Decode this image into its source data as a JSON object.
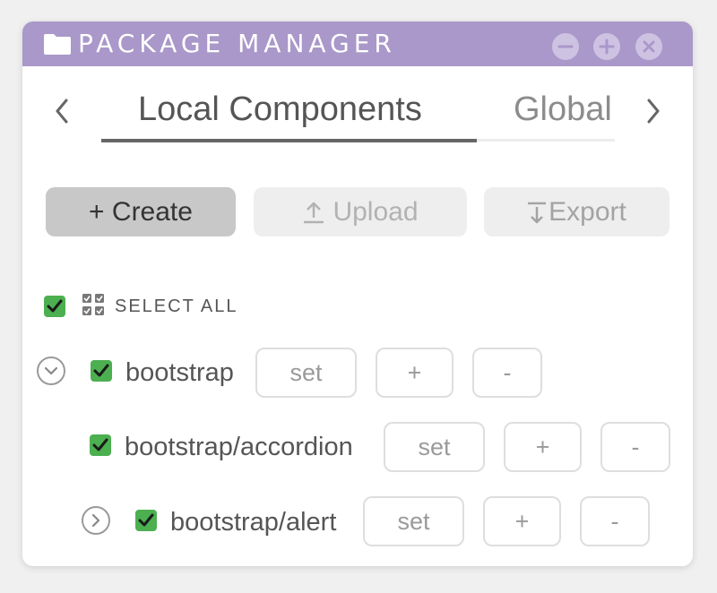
{
  "window": {
    "title": "PACKAGE MANAGER",
    "accent_color": "#a998c9",
    "controls": [
      "minimize-icon",
      "maximize-icon",
      "close-icon"
    ]
  },
  "tabs": {
    "items": [
      {
        "label": "Local Components",
        "active": true
      },
      {
        "label": "Global",
        "active": false
      }
    ]
  },
  "toolbar": {
    "create_label": "+ Create",
    "upload_label": "Upload",
    "export_label": "Export"
  },
  "select_all": {
    "label": "SELECT ALL",
    "checked": true
  },
  "packages": [
    {
      "name": "bootstrap",
      "checked": true,
      "expander": "collapse",
      "set_label": "set",
      "add_label": "+",
      "remove_label": "-"
    },
    {
      "name": "bootstrap/accordion",
      "checked": true,
      "expander": null,
      "set_label": "set",
      "add_label": "+",
      "remove_label": "-"
    },
    {
      "name": "bootstrap/alert",
      "checked": true,
      "expander": "expand",
      "set_label": "set",
      "add_label": "+",
      "remove_label": "-"
    }
  ],
  "colors": {
    "checkbox": "#4caf50",
    "titlebar": "#a998c9"
  }
}
